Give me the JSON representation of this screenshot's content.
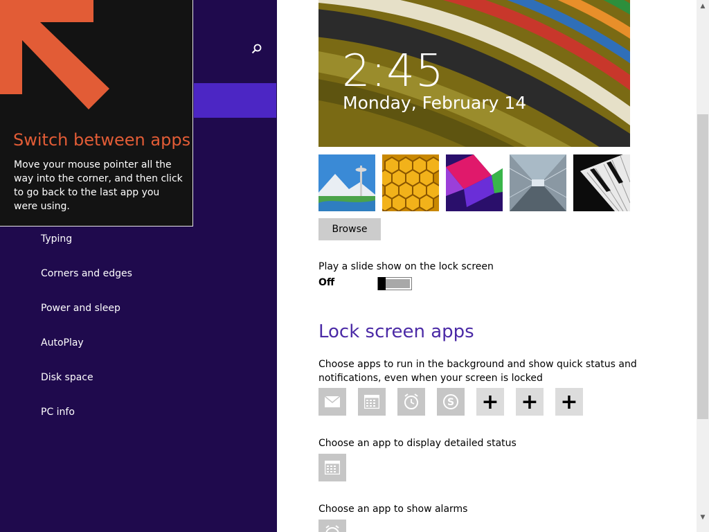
{
  "sidebar": {
    "search_icon": "search-icon",
    "items": [
      {
        "label": "Typing"
      },
      {
        "label": "Corners and edges"
      },
      {
        "label": "Power and sleep"
      },
      {
        "label": "AutoPlay"
      },
      {
        "label": "Disk space"
      },
      {
        "label": "PC info"
      }
    ]
  },
  "tip": {
    "title": "Switch between apps",
    "body": "Move your mouse pointer all the way into the corner, and then click to go back to the last app you were using."
  },
  "lock_preview": {
    "time": "2:45",
    "date": "Monday, February 14"
  },
  "thumbnails": [
    {
      "name": "space-needle-mountain",
      "selected": true
    },
    {
      "name": "honeycomb"
    },
    {
      "name": "geometric-shapes"
    },
    {
      "name": "tunnel-motion"
    },
    {
      "name": "piano-keys"
    }
  ],
  "browse_label": "Browse",
  "slideshow": {
    "label": "Play a slide show on the lock screen",
    "state": "Off"
  },
  "lock_apps": {
    "heading": "Lock screen apps",
    "description": "Choose apps to run in the background and show quick status and notifications, even when your screen is locked",
    "tiles": [
      "mail-icon",
      "calendar-icon",
      "alarm-icon",
      "skype-icon",
      "plus-icon",
      "plus-icon",
      "plus-icon"
    ],
    "add_symbol": "+"
  },
  "detailed_status_label": "Choose an app to display detailed status",
  "alarms_label": "Choose an app to show alarms",
  "colors": {
    "sidebar_bg": "#1f0a4d",
    "accent": "#4c26c4",
    "tip_title": "#e25c36",
    "heading": "#4b2aa6"
  }
}
